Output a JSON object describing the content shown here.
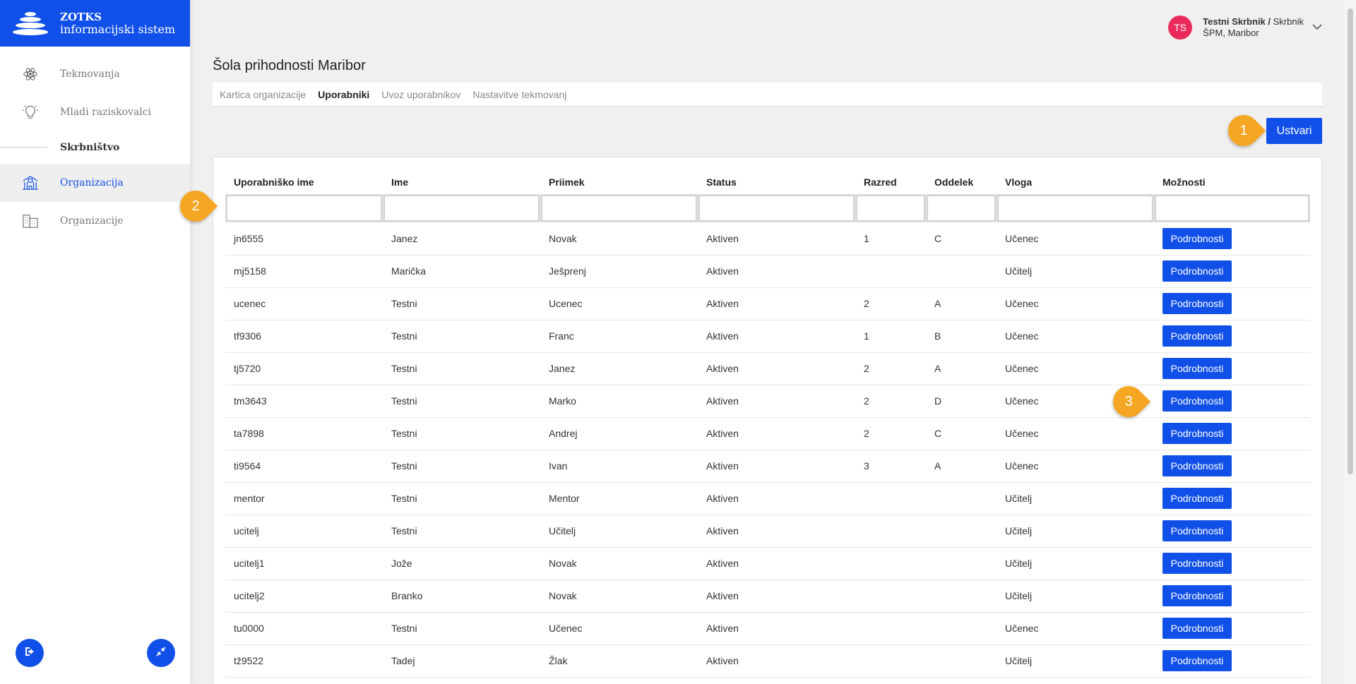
{
  "brand": {
    "line1": "ZOTKS",
    "line2": "informacijski sistem"
  },
  "sidebar": {
    "items": [
      {
        "label": "Tekmovanja",
        "icon": "atom-icon"
      },
      {
        "label": "Mladi raziskovalci",
        "icon": "lightbulb-icon"
      }
    ],
    "section": "Skrbništvo",
    "section_items": [
      {
        "label": "Organizacija",
        "icon": "building-columns-icon",
        "active": true
      },
      {
        "label": "Organizacije",
        "icon": "buildings-icon",
        "active": false
      }
    ]
  },
  "user": {
    "initials": "TS",
    "name": "Testni Skrbnik /",
    "role": "Skrbnik",
    "org": "ŠPM, Maribor"
  },
  "page": {
    "title": "Šola prihodnosti Maribor"
  },
  "tabs": [
    "Kartica organizacije",
    "Uporabniki",
    "Uvoz uporabnikov",
    "Nastavitve tekmovanj"
  ],
  "active_tab": "Uporabniki",
  "create_label": "Ustvari",
  "badges": [
    "1",
    "2",
    "3"
  ],
  "table": {
    "columns": [
      "Uporabniško ime",
      "Ime",
      "Priimek",
      "Status",
      "Razred",
      "Oddelek",
      "Vloga",
      "Možnosti"
    ],
    "action_label": "Podrobnosti",
    "rows": [
      [
        "jn6555",
        "Janez",
        "Novak",
        "Aktiven",
        "1",
        "C",
        "Učenec"
      ],
      [
        "mj5158",
        "Marička",
        "Ješprenj",
        "Aktiven",
        "",
        "",
        "Učitelj"
      ],
      [
        "ucenec",
        "Testni",
        "Ucenec",
        "Aktiven",
        "2",
        "A",
        "Učenec"
      ],
      [
        "tf9306",
        "Testni",
        "Franc",
        "Aktiven",
        "1",
        "B",
        "Učenec"
      ],
      [
        "tj5720",
        "Testni",
        "Janez",
        "Aktiven",
        "2",
        "A",
        "Učenec"
      ],
      [
        "tm3643",
        "Testni",
        "Marko",
        "Aktiven",
        "2",
        "D",
        "Učenec"
      ],
      [
        "ta7898",
        "Testni",
        "Andrej",
        "Aktiven",
        "2",
        "C",
        "Učenec"
      ],
      [
        "ti9564",
        "Testni",
        "Ivan",
        "Aktiven",
        "3",
        "A",
        "Učenec"
      ],
      [
        "mentor",
        "Testni",
        "Mentor",
        "Aktiven",
        "",
        "",
        "Učitelj"
      ],
      [
        "ucitelj",
        "Testni",
        "Učitelj",
        "Aktiven",
        "",
        "",
        "Učitelj"
      ],
      [
        "ucitelj1",
        "Jože",
        "Novak",
        "Aktiven",
        "",
        "",
        "Učitelj"
      ],
      [
        "ucitelj2",
        "Branko",
        "Novak",
        "Aktiven",
        "",
        "",
        "Učitelj"
      ],
      [
        "tu0000",
        "Testni",
        "Učenec",
        "Aktiven",
        "",
        "",
        "Učenec"
      ],
      [
        "tž9522",
        "Tadej",
        "Žlak",
        "Aktiven",
        "",
        "",
        "Učitelj"
      ]
    ]
  },
  "colors": {
    "primary": "#1150e8",
    "badge": "#f5a623",
    "avatar": "#ea2a5b"
  }
}
